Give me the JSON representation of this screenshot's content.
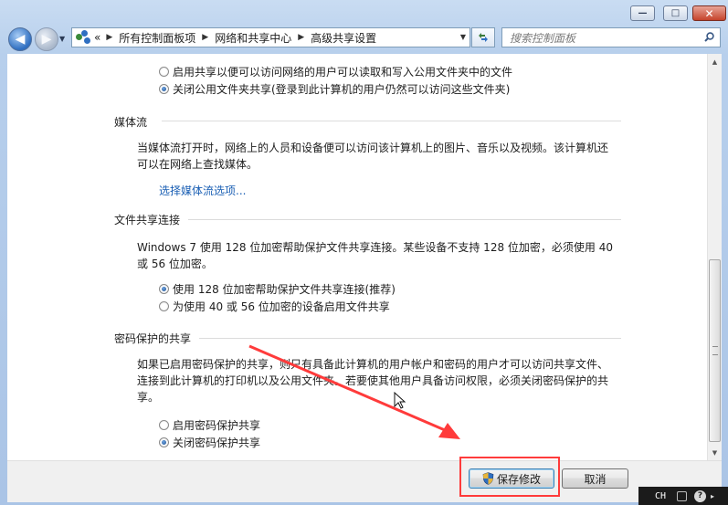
{
  "window": {
    "minimize_glyph": "—",
    "maximize_glyph": "□",
    "close_glyph": "✕"
  },
  "nav": {
    "back_arrow": "◀",
    "forward_arrow": "▶",
    "breadcrumb_lead": "«",
    "breadcrumbs": [
      "所有控制面板项",
      "网络和共享中心",
      "高级共享设置"
    ],
    "search_placeholder": "搜索控制面板"
  },
  "content": {
    "public_folder": {
      "options": [
        {
          "label": "启用共享以便可以访问网络的用户可以读取和写入公用文件夹中的文件",
          "selected": false
        },
        {
          "label": "关闭公用文件夹共享(登录到此计算机的用户仍然可以访问这些文件夹)",
          "selected": true
        }
      ]
    },
    "media_streaming": {
      "title": "媒体流",
      "description_lines": [
        "当媒体流打开时，网络上的人员和设备便可以访问该计算机上的图片、音乐以及视频。该计算机还",
        "可以在网络上查找媒体。"
      ],
      "link": "选择媒体流选项..."
    },
    "file_sharing": {
      "title": "文件共享连接",
      "description_lines": [
        "Windows 7 使用 128 位加密帮助保护文件共享连接。某些设备不支持 128 位加密，必须使用 40",
        "或 56 位加密。"
      ],
      "options": [
        {
          "label": "使用 128 位加密帮助保护文件共享连接(推荐)",
          "selected": true
        },
        {
          "label": "为使用 40 或 56 位加密的设备启用文件共享",
          "selected": false
        }
      ]
    },
    "password_sharing": {
      "title": "密码保护的共享",
      "description_lines": [
        "如果已启用密码保护的共享，则只有具备此计算机的用户帐户和密码的用户才可以访问共享文件、",
        "连接到此计算机的打印机以及公用文件夹。若要使其他用户具备访问权限，必须关闭密码保护的共",
        "享。"
      ],
      "options": [
        {
          "label": "启用密码保护共享",
          "selected": false
        },
        {
          "label": "关闭密码保护共享",
          "selected": true
        }
      ]
    }
  },
  "footer": {
    "save_label": "保存修改",
    "cancel_label": "取消"
  },
  "taskbar": {
    "ime_label": "CH",
    "help_glyph": "?",
    "tray_arrow": "▸"
  },
  "colors": {
    "link": "#1a5fb4",
    "annotation": "#ff3b3b",
    "frame": "#b7cfec"
  }
}
